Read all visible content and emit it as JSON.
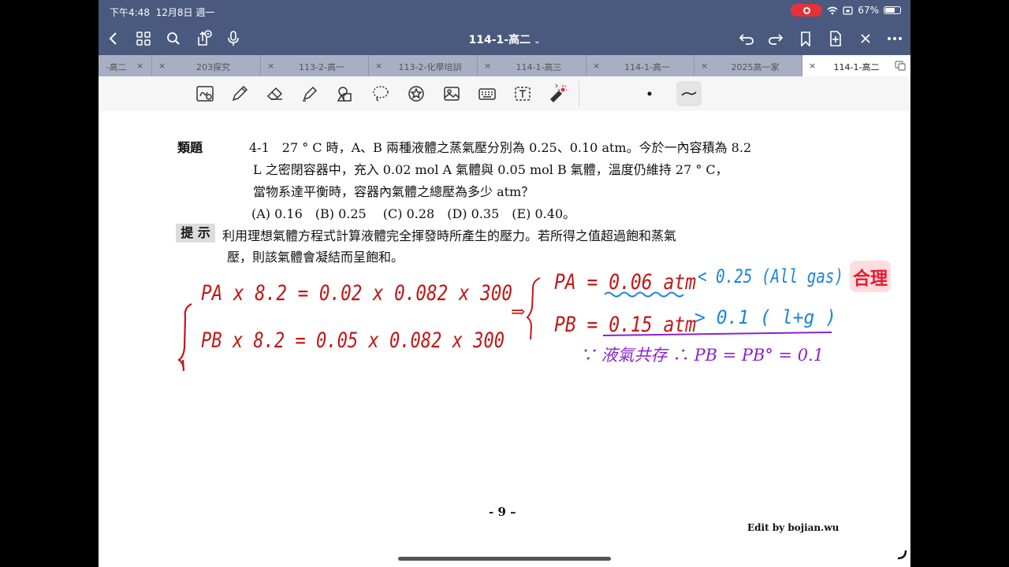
{
  "status": {
    "time": "下午4:48",
    "date": "12月8日 週一",
    "battery": "67%",
    "recording": true,
    "battery_level": 0.67
  },
  "nav": {
    "title": "114-1-高二",
    "icons": [
      "back-icon",
      "grid-icon",
      "search-icon",
      "share-icon",
      "microphone-icon",
      "undo-icon",
      "redo-icon",
      "bookmark-icon",
      "add-page-icon",
      "close-cross-icon",
      "more-icon"
    ]
  },
  "tabs": [
    {
      "label": "-高二",
      "active": false
    },
    {
      "label": "203探究",
      "active": false
    },
    {
      "label": "113-2-高一",
      "active": false
    },
    {
      "label": "113-2-化學培訓",
      "active": false
    },
    {
      "label": "114-1-高三",
      "active": false
    },
    {
      "label": "114-1-高一",
      "active": false
    },
    {
      "label": "2025高一家",
      "active": false
    },
    {
      "label": "114-1-高二",
      "active": true
    }
  ],
  "toolbar": {
    "tools": [
      "lasso-text-icon",
      "pen-icon",
      "eraser-icon",
      "highlighter-icon",
      "shapes-icon",
      "lasso-icon",
      "sticker-icon",
      "image-icon",
      "keyboard-icon",
      "textbox-icon",
      "laser-pointer-icon"
    ],
    "selected": "stroke-style-icon"
  },
  "document": {
    "question_label": "類題",
    "question_line1": "4-1　27 ° C 時，A、B 兩種液體之蒸氣壓分別為 0.25、0.10 atm。今於一內容積為 8.2",
    "question_line2": "L 之密閉容器中，充入 0.02 mol A 氣體與 0.05 mol B 氣體，溫度仍維持 27 ° C，",
    "question_line3": "當物系達平衡時，容器內氣體之總壓為多少 atm？",
    "options": "(A) 0.16　(B) 0.25　 (C) 0.28　(D) 0.35　(E) 0.40。",
    "hint_label": "提 示",
    "hint_line1": "利用理想氣體方程式計算液體完全揮發時所產生的壓力。若所得之值超過飽和蒸氣",
    "hint_line2": "壓，則該氣體會凝結而呈飽和。",
    "page_number": "- 9 –",
    "footer": "Edit by bojian.wu"
  },
  "handwriting": {
    "eq1": "PA x 8.2 = 0.02 x 0.082 x 300",
    "eq2": "PB x 8.2 = 0.05 x 0.082 x 300",
    "arrow": "⇒",
    "pa_result": "PA = 0.06 atm",
    "pa_compare": "< 0.25 (All gas)",
    "pb_result": "PB = 0.15 atm",
    "pb_compare": "> 0.1 ( l+g )",
    "conclusion": "∵ 液氣共存 ∴ PB = PB° = 0.1",
    "stamp": "合理"
  },
  "colors": {
    "ink_red": "#c01818",
    "ink_blue": "#1a86d8",
    "ink_purple": "#8a22c8",
    "header_bg": "#4a5a7e",
    "stamp_red": "#e8192c"
  }
}
